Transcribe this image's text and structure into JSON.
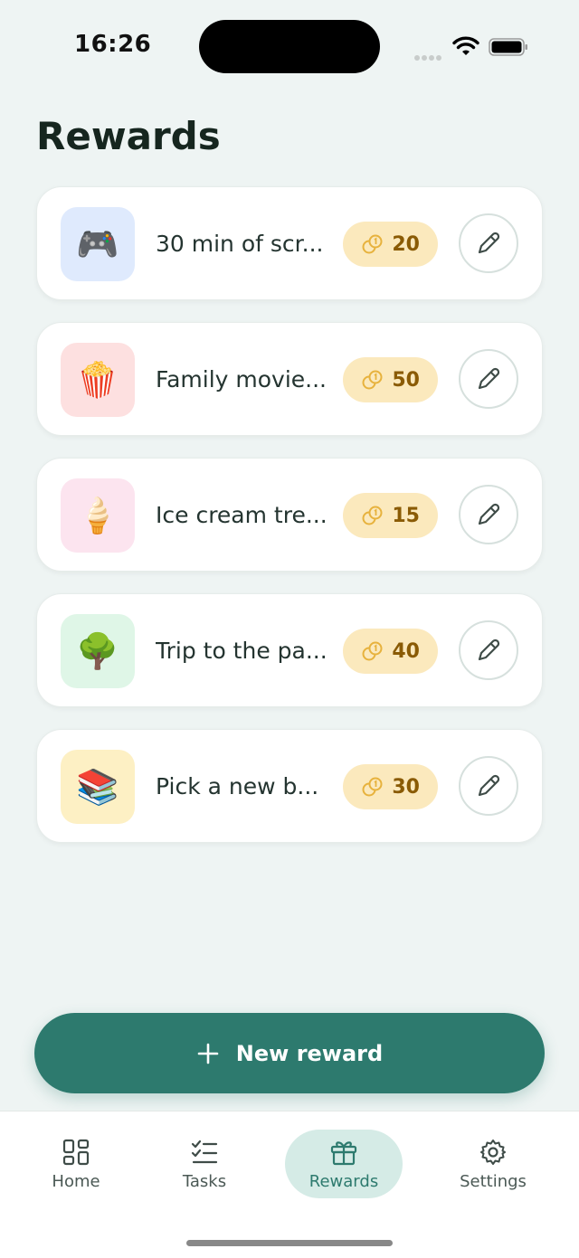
{
  "status_bar": {
    "time": "16:26"
  },
  "page": {
    "title": "Rewards"
  },
  "rewards": [
    {
      "emoji": "🎮",
      "name": "30 min of scr...",
      "points": "20",
      "bg": "#dfeafd"
    },
    {
      "emoji": "🍿",
      "name": "Family movie...",
      "points": "50",
      "bg": "#fde0e0"
    },
    {
      "emoji": "🍦",
      "name": "Ice cream tre...",
      "points": "15",
      "bg": "#fce4ef"
    },
    {
      "emoji": "🌳",
      "name": "Trip to the pa...",
      "points": "40",
      "bg": "#dff6e7"
    },
    {
      "emoji": "📚",
      "name": "Pick a new b...",
      "points": "30",
      "bg": "#fdf0c4"
    }
  ],
  "actions": {
    "new_reward_label": "New reward"
  },
  "tab_bar": {
    "tabs": [
      {
        "label": "Home",
        "icon": "grid-icon"
      },
      {
        "label": "Tasks",
        "icon": "checklist-icon"
      },
      {
        "label": "Rewards",
        "icon": "gift-icon",
        "active": true
      },
      {
        "label": "Settings",
        "icon": "gear-icon"
      }
    ]
  },
  "colors": {
    "accent": "#2d7a6e",
    "points_pill": "#fbe9bd",
    "points_text": "#8a5b05"
  }
}
